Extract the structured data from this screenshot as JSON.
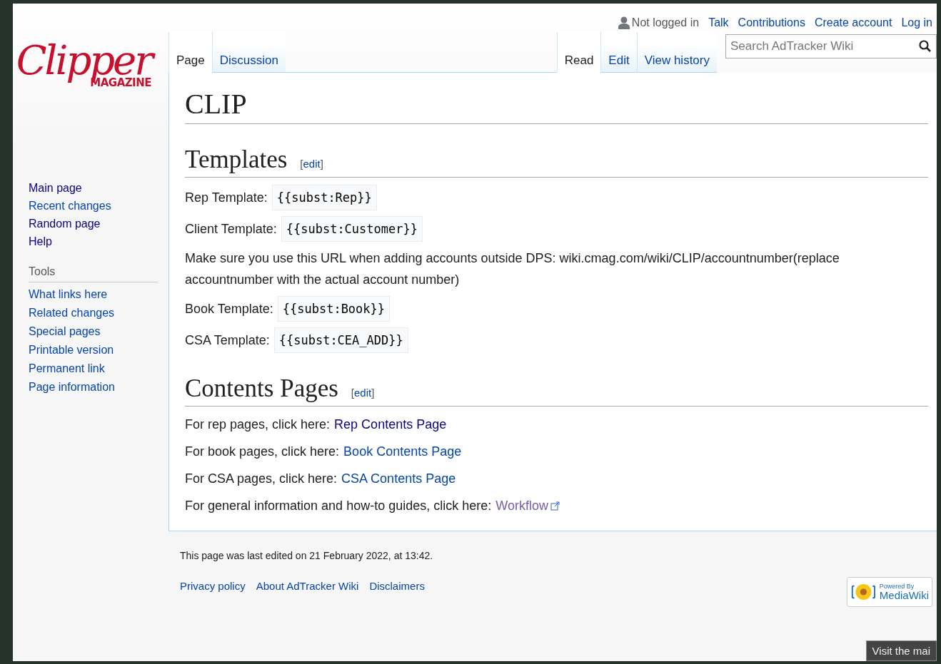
{
  "personal_bar": {
    "status": "Not logged in",
    "links": [
      "Talk",
      "Contributions",
      "Create account",
      "Log in"
    ]
  },
  "logo": {
    "script": "Clipper",
    "sub": "MAGAZINE"
  },
  "left_tabs": [
    {
      "label": "Page",
      "selected": true
    },
    {
      "label": "Discussion",
      "selected": false
    }
  ],
  "right_tabs": [
    {
      "label": "Read",
      "selected": true
    },
    {
      "label": "Edit",
      "selected": false
    },
    {
      "label": "View history",
      "selected": false
    }
  ],
  "search": {
    "placeholder": "Search AdTracker Wiki"
  },
  "sidebar": {
    "navigation": [
      {
        "label": "Main page",
        "visited": true
      },
      {
        "label": "Recent changes",
        "visited": false
      },
      {
        "label": "Random page",
        "visited": true
      },
      {
        "label": "Help",
        "visited": true
      }
    ],
    "tools_heading": "Tools",
    "tools": [
      {
        "label": "What links here",
        "visited": false
      },
      {
        "label": "Related changes",
        "visited": false
      },
      {
        "label": "Special pages",
        "visited": false
      },
      {
        "label": "Printable version",
        "visited": false
      },
      {
        "label": "Permanent link",
        "visited": false
      },
      {
        "label": "Page information",
        "visited": false
      }
    ]
  },
  "title": "CLIP",
  "sections": [
    {
      "heading": "Templates",
      "edit": {
        "open": "[",
        "label": "edit",
        "close": "]"
      },
      "lines": [
        {
          "kind": "template",
          "label": "Rep Template:",
          "code": "{{subst:Rep}}"
        },
        {
          "kind": "template",
          "label": "Client Template:",
          "code": "{{subst:Customer}}"
        },
        {
          "kind": "text",
          "text": "Make sure you use this URL when adding accounts outside DPS: wiki.cmag.com/wiki/CLIP/accountnumber(replace accountnumber with the actual account number)"
        },
        {
          "kind": "template",
          "label": "Book Template:",
          "code": "{{subst:Book}}"
        },
        {
          "kind": "template",
          "label": "CSA Template:",
          "code": "{{subst:CEA_ADD}}"
        }
      ]
    },
    {
      "heading": "Contents Pages",
      "edit": {
        "open": "[",
        "label": "edit",
        "close": "]"
      },
      "lines": [
        {
          "kind": "link",
          "label": "For rep pages, click here:",
          "link": "Rep Contents Page",
          "visited": true,
          "external": false
        },
        {
          "kind": "link",
          "label": "For book pages, click here:",
          "link": "Book Contents Page",
          "visited": false,
          "external": false
        },
        {
          "kind": "link",
          "label": "For CSA pages, click here:",
          "link": "CSA Contents Page",
          "visited": false,
          "external": false
        },
        {
          "kind": "link",
          "label": "For general information and how-to guides, click here:",
          "link": "Workflow",
          "visited": true,
          "external": true
        }
      ]
    }
  ],
  "footer": {
    "last_edited": "This page was last edited on 21 February 2022, at 13:42.",
    "links": [
      "Privacy policy",
      "About AdTracker Wiki",
      "Disclaimers"
    ],
    "badge": {
      "top": "Powered By",
      "bottom": "MediaWiki"
    }
  },
  "tooltip": "Visit the mai"
}
